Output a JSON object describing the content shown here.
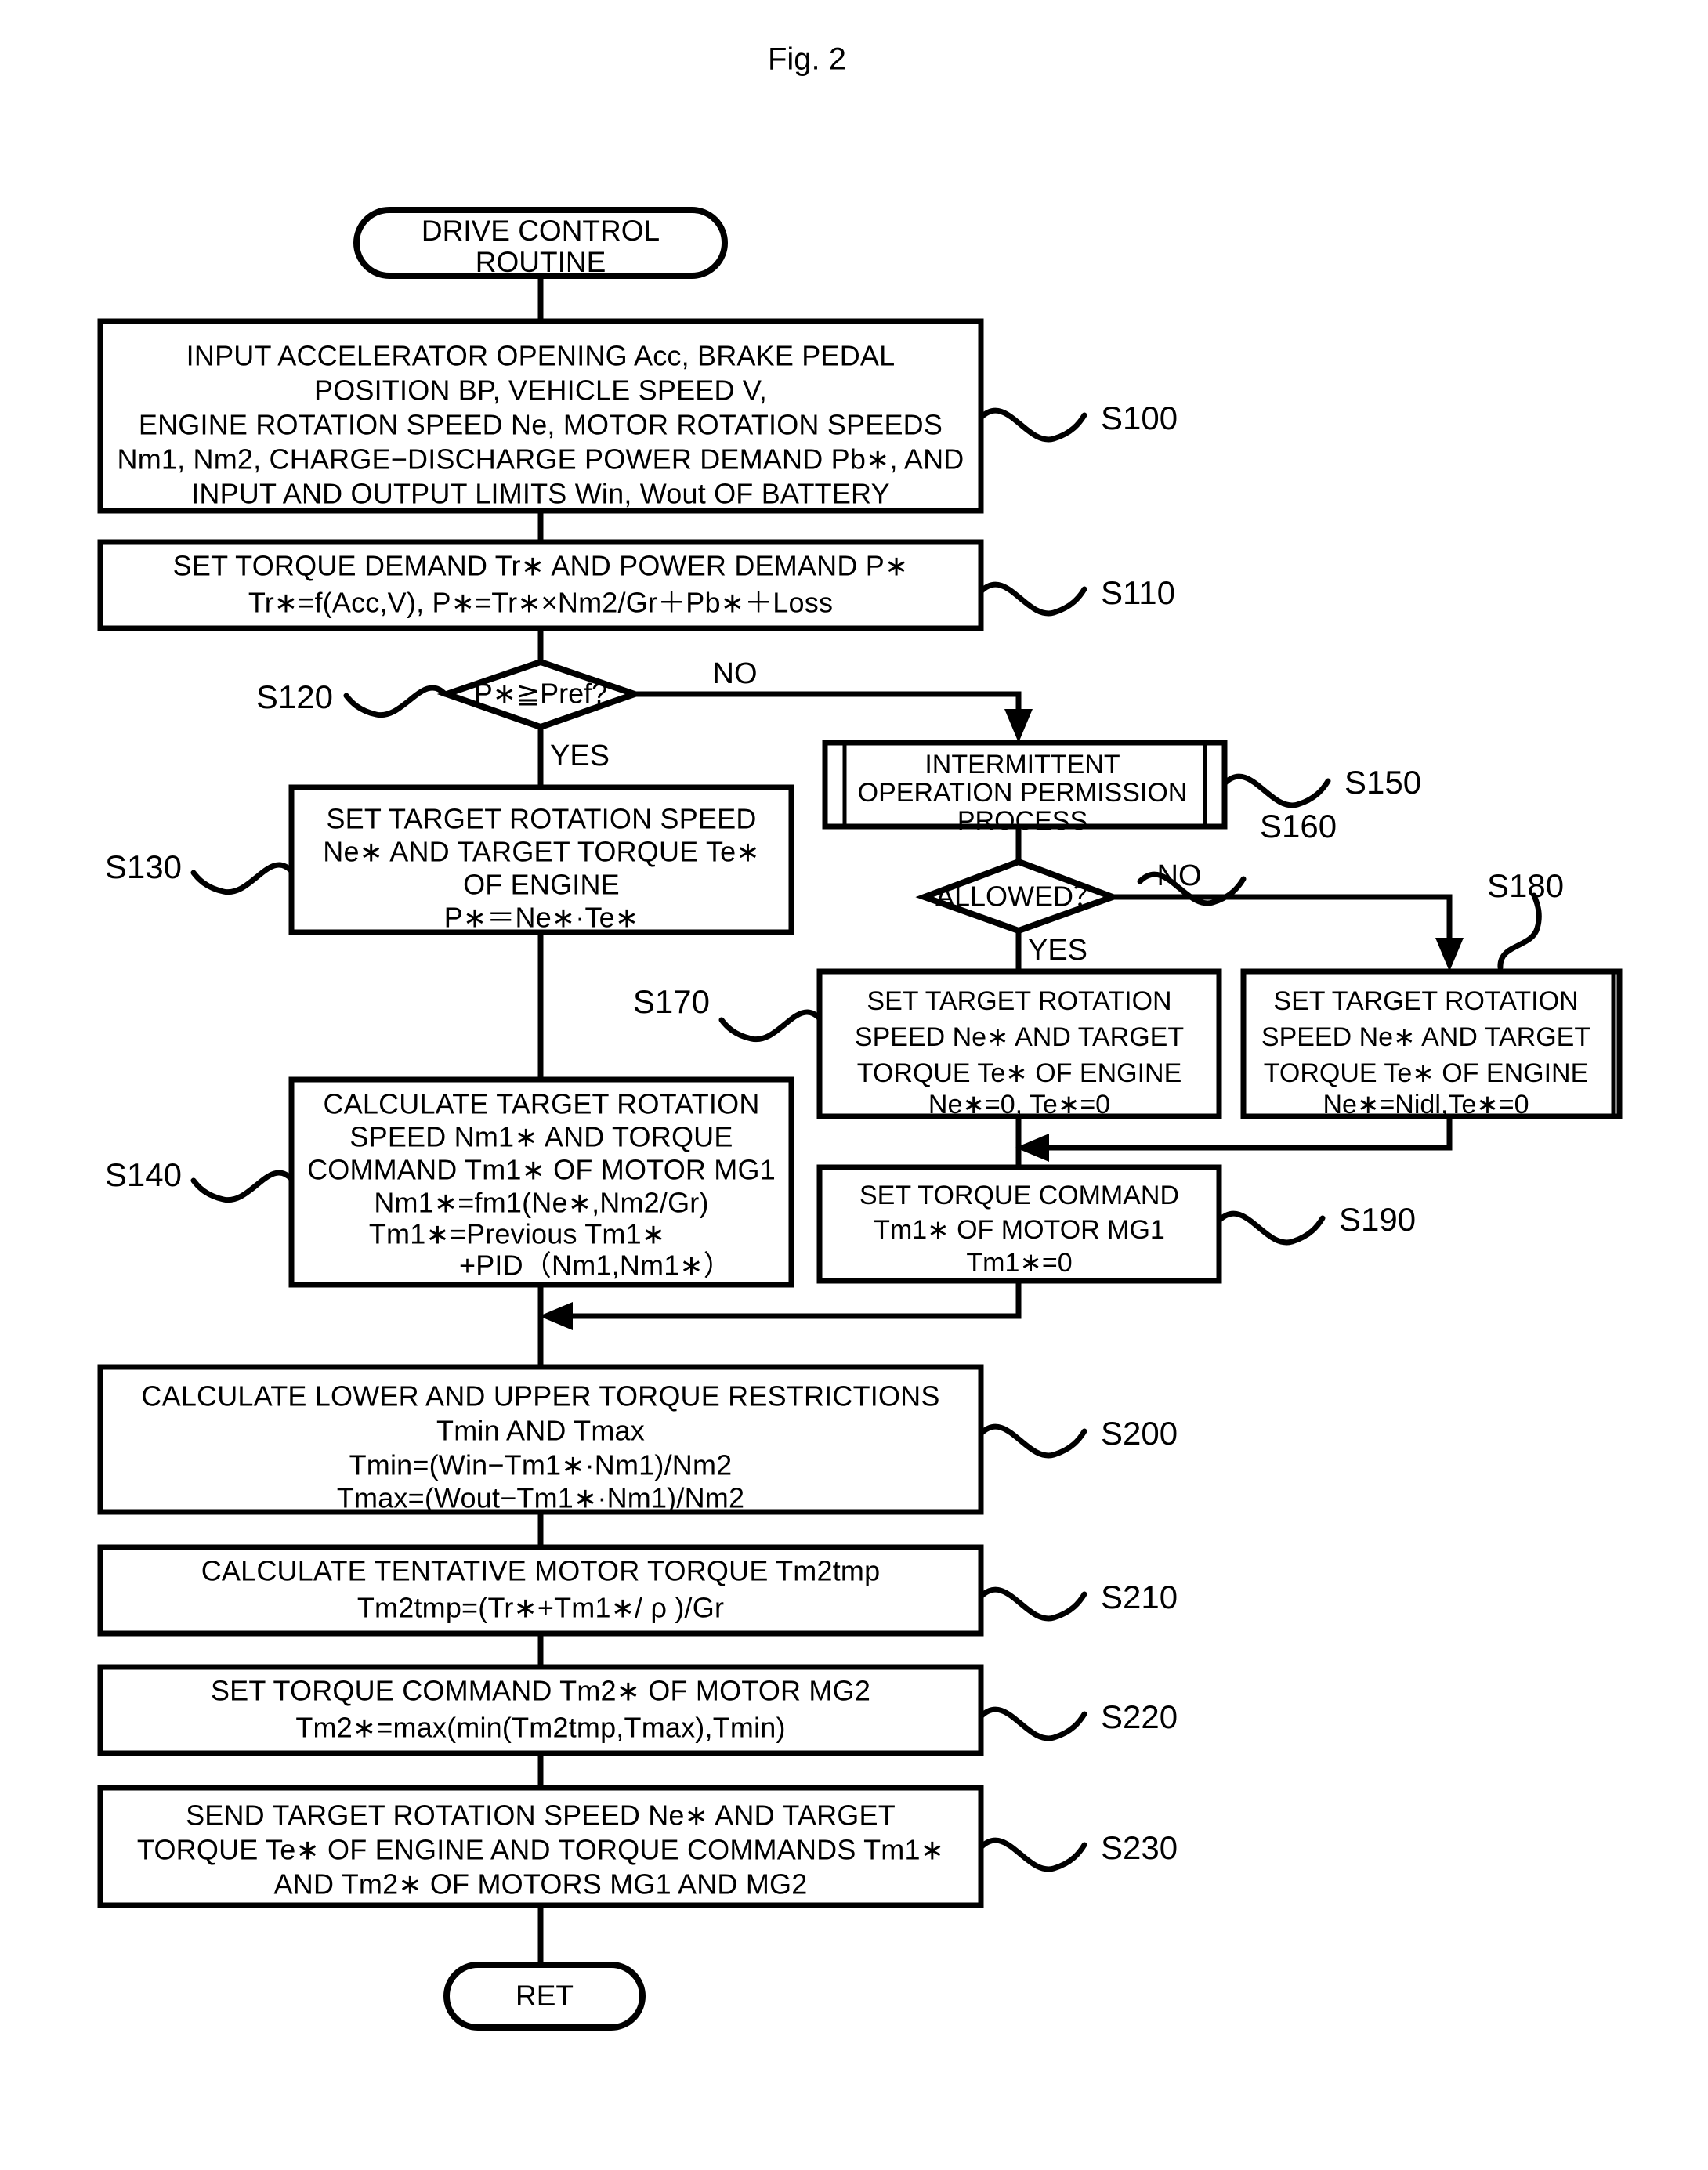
{
  "figure": {
    "label": "Fig. 2"
  },
  "nodes": {
    "start": {
      "type": "terminator",
      "lines": [
        "DRIVE CONTROL",
        "ROUTINE"
      ]
    },
    "s100": {
      "step": "S100",
      "type": "process",
      "lines": [
        "INPUT ACCELERATOR OPENING Acc, BRAKE PEDAL",
        "POSITION BP, VEHICLE SPEED V,",
        "ENGINE ROTATION SPEED Ne, MOTOR ROTATION SPEEDS",
        "Nm1, Nm2, CHARGE−DISCHARGE POWER DEMAND Pb∗, AND",
        "INPUT AND OUTPUT LIMITS Win, Wout OF BATTERY"
      ]
    },
    "s110": {
      "step": "S110",
      "type": "process",
      "lines": [
        "SET TORQUE DEMAND Tr∗ AND POWER DEMAND P∗",
        "Tr∗=f(Acc,V),     P∗=Tr∗×Nm2/Gr＋Pb∗＋Loss"
      ]
    },
    "s120": {
      "step": "S120",
      "type": "decision",
      "lines": [
        "P∗≧Pref?"
      ],
      "yes_label": "YES",
      "no_label": "NO"
    },
    "s130": {
      "step": "S130",
      "type": "process",
      "lines": [
        "SET TARGET ROTATION SPEED",
        "Ne∗ AND TARGET TORQUE Te∗",
        "OF ENGINE",
        "P∗＝Ne∗·Te∗"
      ]
    },
    "s140": {
      "step": "S140",
      "type": "process",
      "lines": [
        "CALCULATE TARGET ROTATION",
        "SPEED Nm1∗ AND TORQUE",
        "COMMAND Tm1∗ OF MOTOR MG1",
        "Nm1∗=fm1(Ne∗,Nm2/Gr)",
        "Tm1∗=Previous Tm1∗",
        "+PID（Nm1,Nm1∗）"
      ]
    },
    "s150": {
      "step": "S150",
      "type": "predefined-process",
      "lines": [
        "INTERMITTENT",
        "OPERATION PERMISSION",
        "PROCESS"
      ]
    },
    "s160": {
      "step": "S160",
      "type": "decision",
      "lines": [
        "ALLOWED？"
      ],
      "yes_label": "YES",
      "no_label": "NO"
    },
    "s170": {
      "step": "S170",
      "type": "process",
      "lines": [
        "SET TARGET ROTATION",
        "SPEED Ne∗ AND TARGET",
        "TORQUE Te∗ OF ENGINE",
        "Ne∗=0,  Te∗=0"
      ]
    },
    "s180": {
      "step": "S180",
      "type": "process",
      "lines": [
        "SET TARGET ROTATION",
        "SPEED Ne∗ AND TARGET",
        "TORQUE Te∗ OF ENGINE",
        "Ne∗=Nidl,Te∗=0"
      ]
    },
    "s190": {
      "step": "S190",
      "type": "process",
      "lines": [
        "SET TORQUE COMMAND",
        "Tm1∗ OF MOTOR MG1",
        "Tm1∗=0"
      ]
    },
    "s200": {
      "step": "S200",
      "type": "process",
      "lines": [
        "CALCULATE LOWER AND UPPER TORQUE RESTRICTIONS",
        "Tmin AND Tmax",
        "Tmin=(Win−Tm1∗·Nm1)/Nm2",
        "Tmax=(Wout−Tm1∗·Nm1)/Nm2"
      ]
    },
    "s210": {
      "step": "S210",
      "type": "process",
      "lines": [
        "CALCULATE TENTATIVE MOTOR TORQUE Tm2tmp",
        "Tm2tmp=(Tr∗+Tm1∗/ ρ )/Gr"
      ]
    },
    "s220": {
      "step": "S220",
      "type": "process",
      "lines": [
        "SET TORQUE COMMAND Tm2∗ OF MOTOR MG2",
        "Tm2∗=max(min(Tm2tmp,Tmax),Tmin)"
      ]
    },
    "s230": {
      "step": "S230",
      "type": "process",
      "lines": [
        "SEND TARGET ROTATION SPEED Ne∗ AND TARGET",
        "TORQUE Te∗ OF ENGINE AND TORQUE COMMANDS Tm1∗",
        "AND Tm2∗ OF MOTORS MG1 AND MG2"
      ]
    },
    "end": {
      "type": "terminator",
      "lines": [
        "RET"
      ]
    }
  },
  "flowchart_meta": {
    "ink_color": "#000000",
    "background_color": "#ffffff"
  }
}
